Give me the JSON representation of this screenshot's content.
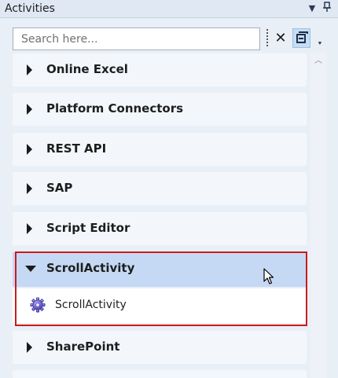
{
  "panel": {
    "title": "Activities"
  },
  "titlebar": {
    "dropdown_icon": "▼",
    "pin_icon": "📌"
  },
  "search": {
    "placeholder": "Search here..."
  },
  "toolbar": {
    "clear_label": "✕",
    "more_label": "⯆"
  },
  "categories": [
    {
      "label": "Online Excel"
    },
    {
      "label": "Platform Connectors"
    },
    {
      "label": "REST API"
    },
    {
      "label": "SAP"
    },
    {
      "label": "Script Editor"
    },
    {
      "label": "ScrollActivity",
      "expanded": true,
      "children": [
        {
          "label": "ScrollActivity",
          "icon": "gear-icon"
        }
      ]
    },
    {
      "label": "SharePoint"
    }
  ]
}
